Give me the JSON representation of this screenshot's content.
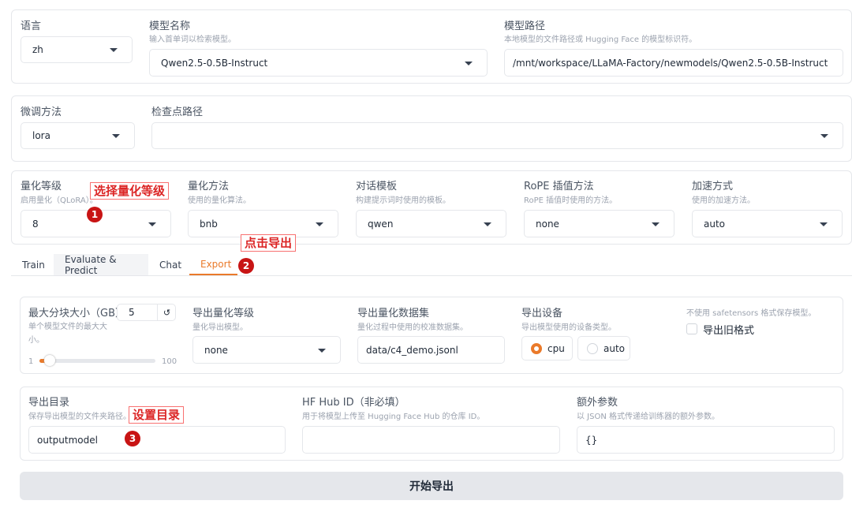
{
  "top": {
    "lang": {
      "label": "语言",
      "value": "zh"
    },
    "model_name": {
      "label": "模型名称",
      "hint": "输入首单词以检索模型。",
      "value": "Qwen2.5-0.5B-Instruct"
    },
    "model_path": {
      "label": "模型路径",
      "hint": "本地模型的文件路径或 Hugging Face 的模型标识符。",
      "value": "/mnt/workspace/LLaMA-Factory/newmodels/Qwen2.5-0.5B-Instruct"
    }
  },
  "second": {
    "finetune": {
      "label": "微调方法",
      "value": "lora"
    },
    "checkpoint": {
      "label": "检查点路径",
      "value": ""
    }
  },
  "third": [
    {
      "label": "量化等级",
      "hint": "启用量化（QLoRA）。",
      "value": "8"
    },
    {
      "label": "量化方法",
      "hint": "使用的量化算法。",
      "value": "bnb"
    },
    {
      "label": "对话模板",
      "hint": "构建提示词时使用的模板。",
      "value": "qwen"
    },
    {
      "label": "RoPE 插值方法",
      "hint": "RoPE 插值时使用的方法。",
      "value": "none"
    },
    {
      "label": "加速方式",
      "hint": "使用的加速方法。",
      "value": "auto"
    }
  ],
  "tabs": [
    {
      "label": "Train"
    },
    {
      "label": "Evaluate & Predict"
    },
    {
      "label": "Chat"
    },
    {
      "label": "Export",
      "active": true
    }
  ],
  "export": {
    "shard": {
      "label": "最大分块大小（GB）",
      "hint": "单个模型文件的最大大小。",
      "value": "5",
      "min": "1",
      "max": "100",
      "slider_value": 5
    },
    "quant_bit": {
      "label": "导出量化等级",
      "hint": "量化导出模型。",
      "value": "none"
    },
    "quant_dataset": {
      "label": "导出量化数据集",
      "hint": "量化过程中使用的校准数据集。",
      "value": "data/c4_demo.jsonl"
    },
    "device": {
      "label": "导出设备",
      "hint": "导出模型使用的设备类型。",
      "options": [
        "cpu",
        "auto"
      ],
      "selected": "cpu"
    },
    "legacy": {
      "hint": "不使用 safetensors 格式保存模型。",
      "label": "导出旧格式",
      "checked": false
    },
    "dir": {
      "label": "导出目录",
      "hint": "保存导出模型的文件夹路径。",
      "value": "outputmodel"
    },
    "hub": {
      "label": "HF Hub ID（非必填）",
      "hint": "用于将模型上传至 Hugging Face Hub 的仓库 ID。",
      "value": ""
    },
    "extra": {
      "label": "额外参数",
      "hint": "以 JSON 格式传递给训练器的额外参数。",
      "value": "{}"
    },
    "button": "开始导出"
  },
  "annotations": [
    {
      "text": "选择量化等级",
      "num": "1"
    },
    {
      "text": "点击导出",
      "num": "2"
    },
    {
      "text": "设置目录",
      "num": "3"
    }
  ],
  "colors": {
    "accent": "#ea7a2a",
    "annotation": "#dc2626"
  }
}
